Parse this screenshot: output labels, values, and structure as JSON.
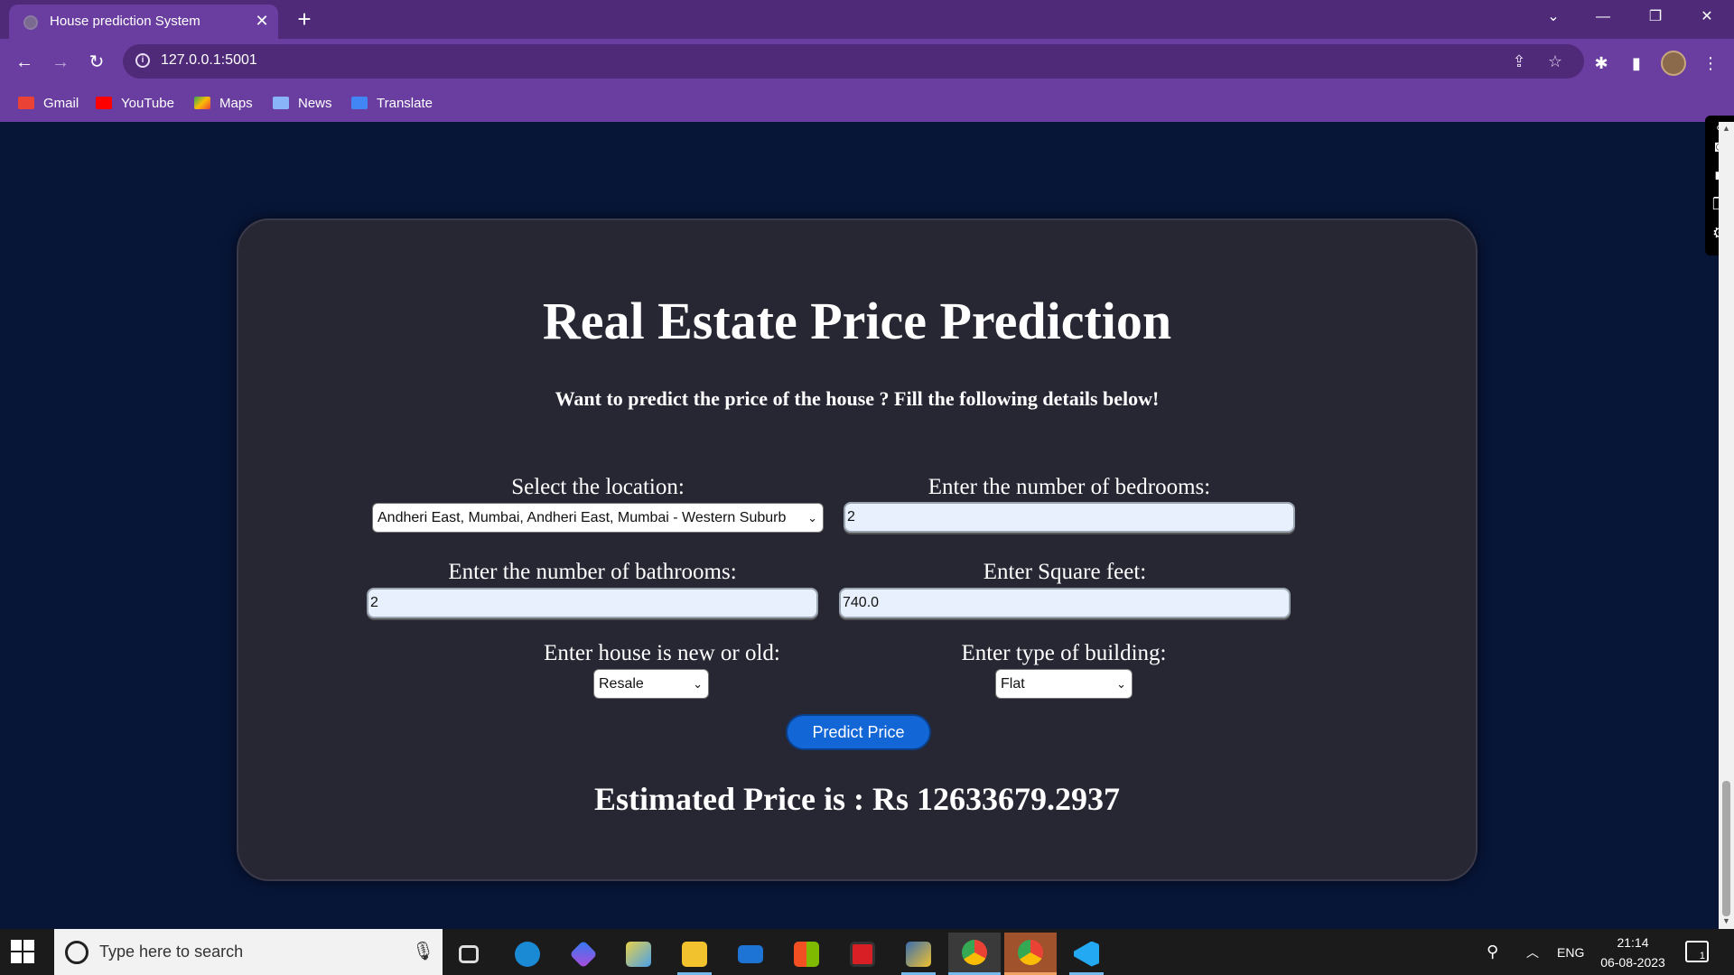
{
  "browser": {
    "tab_title": "House prediction System",
    "tab_close": "✕",
    "new_tab": "+",
    "url": "127.0.0.1:5001",
    "bookmarks": [
      {
        "label": "Gmail",
        "color": "#ea4335"
      },
      {
        "label": "YouTube",
        "color": "#ff0000"
      },
      {
        "label": "Maps",
        "color": "#34a853"
      },
      {
        "label": "News",
        "color": "#4285f4"
      },
      {
        "label": "Translate",
        "color": "#4285f4"
      }
    ]
  },
  "page": {
    "title": "Real Estate Price Prediction",
    "subtitle": "Want to predict the price of the house ? Fill the following details below!",
    "location_label": "Select the location:",
    "location_value": "Andheri East, Mumbai, Andheri East, Mumbai - Western Suburb",
    "bedrooms_label": "Enter the number of bedrooms:",
    "bedrooms_value": "2",
    "bathrooms_label": "Enter the number of bathrooms:",
    "bathrooms_value": "2",
    "sqft_label": "Enter Square feet:",
    "sqft_value": "740.0",
    "newold_label": "Enter house is new or old:",
    "newold_value": "Resale",
    "building_label": "Enter type of building:",
    "building_value": "Flat",
    "predict_button": "Predict Price",
    "result": "Estimated Price is : Rs 12633679.2937"
  },
  "taskbar": {
    "search_placeholder": "Type here to search",
    "language": "ENG",
    "time": "21:14",
    "date": "06-08-2023",
    "notification_count": "1"
  },
  "colors": {
    "chrome_purple": "#6a3ea1",
    "page_background": "#071537",
    "card_background": "#272633",
    "button_blue": "#1366d6"
  }
}
